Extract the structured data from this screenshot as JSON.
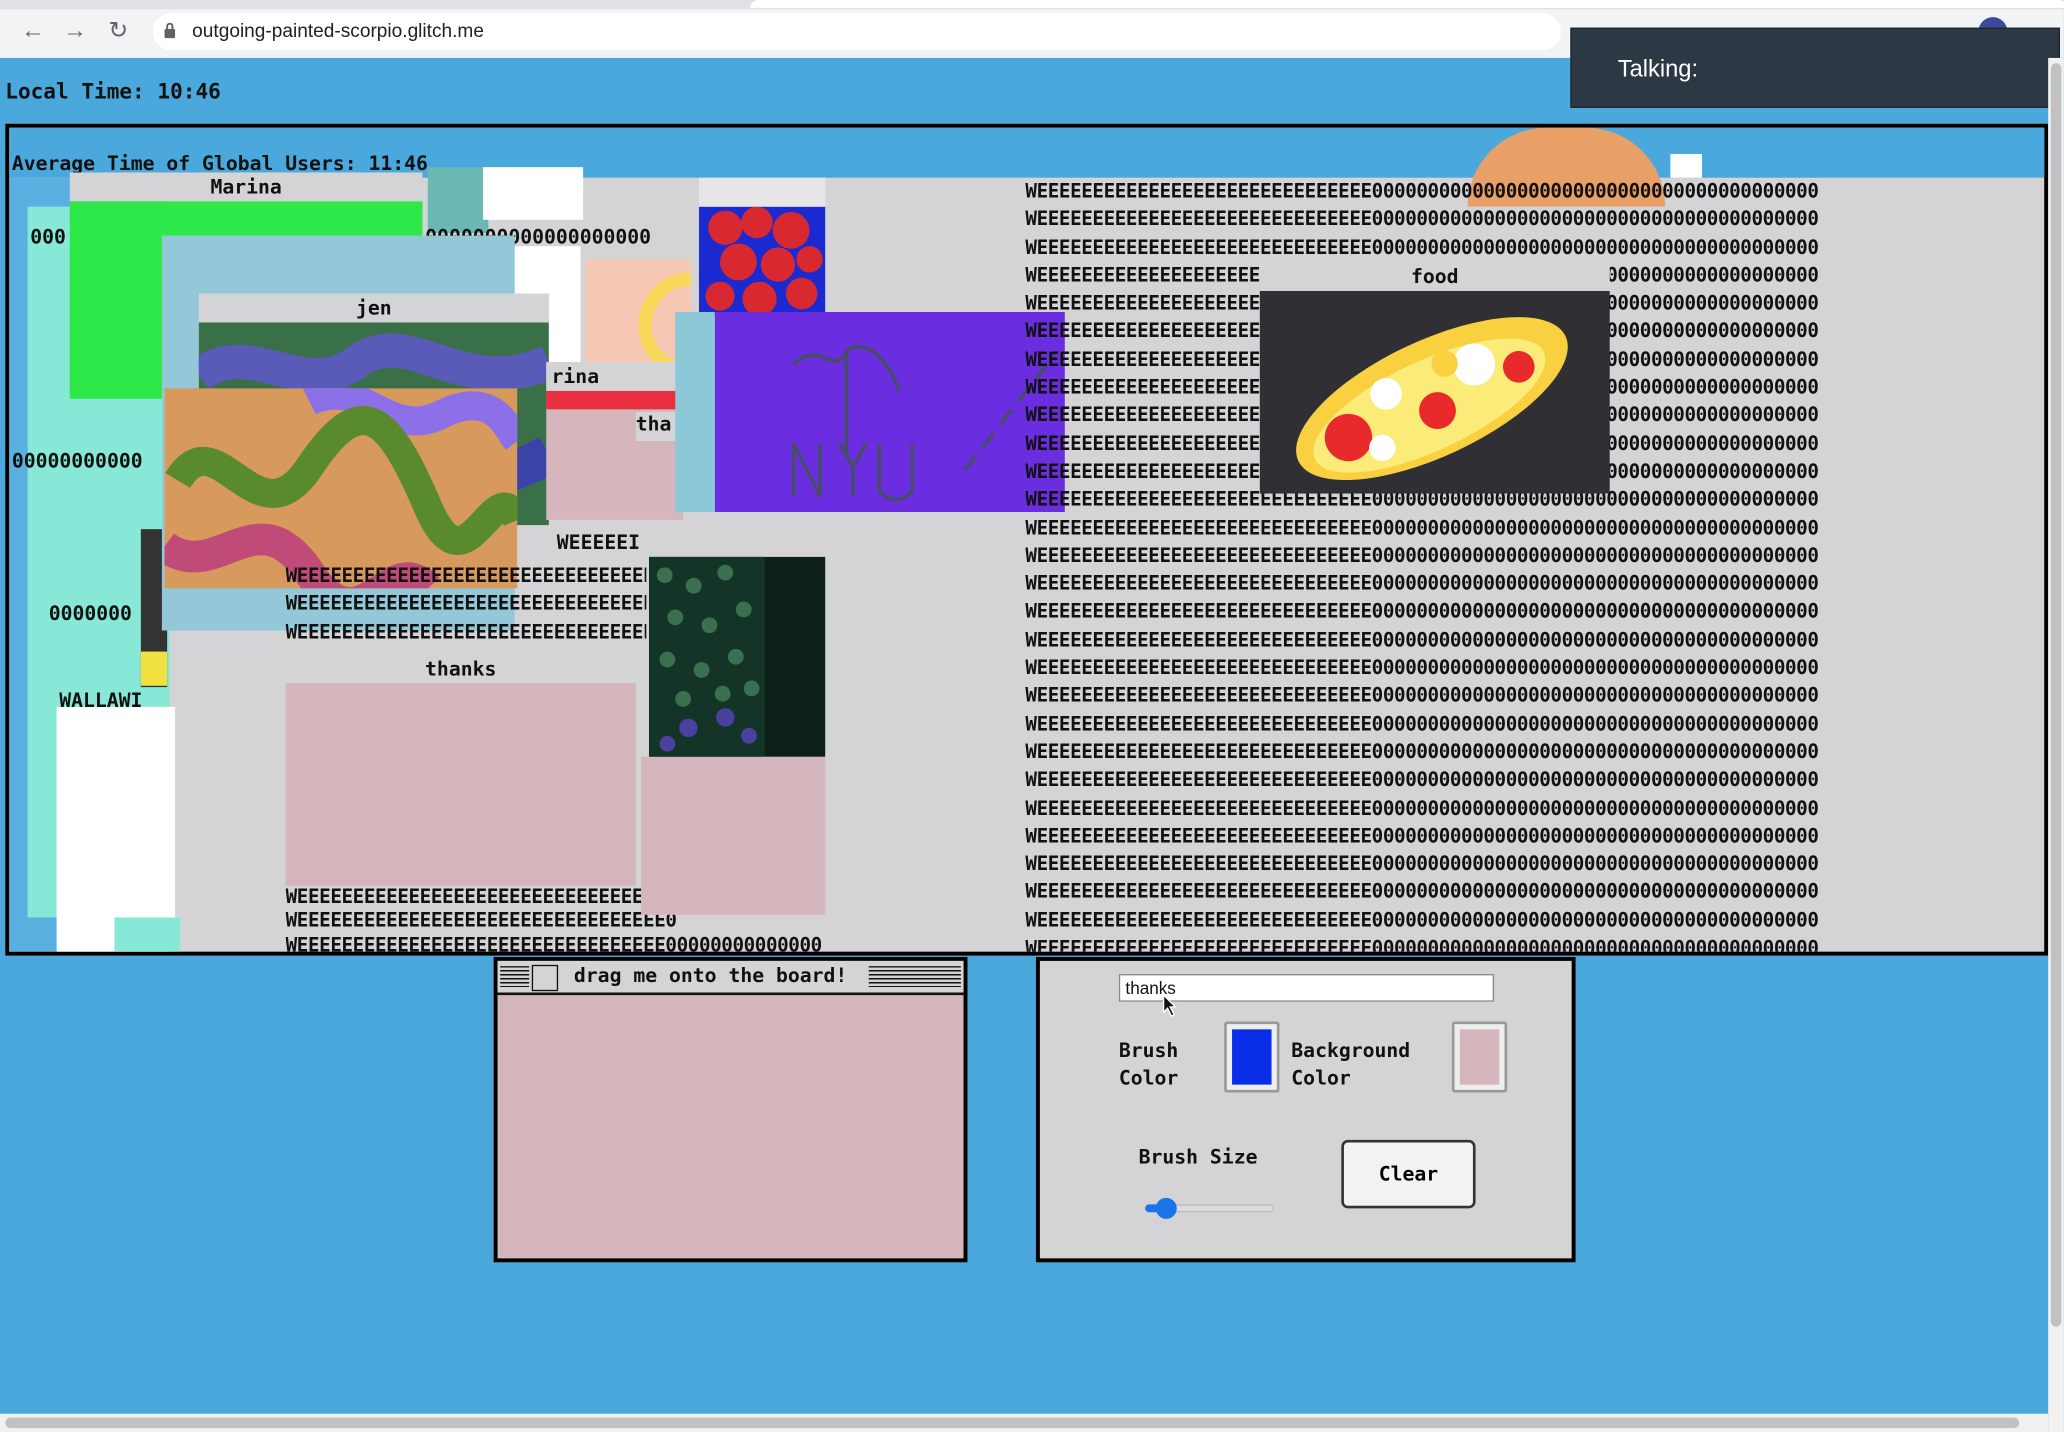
{
  "browser": {
    "url": "outgoing-painted-scorpio.glitch.me",
    "back_icon": "back-arrow-icon",
    "forward_icon": "forward-arrow-icon",
    "reload_icon": "reload-icon",
    "lock_icon": "lock-icon"
  },
  "talking_label": "Talking:",
  "local_time": "Local Time: 10:46",
  "average_time": "Average Time of Global Users: 11:46",
  "board": {
    "windows": {
      "marina": "Marina",
      "jen": "jen",
      "rina": "rina",
      "tha": "tha",
      "thanks": "thanks",
      "food": "food",
      "weeee_small": "WEEEEEI"
    },
    "fragments": {
      "zeros_a": "000",
      "zeros_b": "0000000000000000000",
      "zeros_c": "00000000000",
      "zeros_d": "0000000",
      "wallaw": "WALLAWI"
    },
    "wee_line": "WEEEEEEEEEEEEEEEEEEEEEEEEEEEEEE0000000000000000000000000000000000000000",
    "wee_left_line": "WEEEEEEEEEEEEEEEEEEEEEEEEEEEEEEEEE0",
    "wee_left_last": "WEEEEEEEEEEEEEEEEEEEEEEEEEEEEEEEEE00000000000000"
  },
  "drag_window": {
    "title": "drag me onto the board!"
  },
  "controls": {
    "title_input_value": "thanks",
    "brush_color_label_1": "Brush",
    "brush_color_label_2": "Color",
    "background_color_label_1": "Background",
    "background_color_label_2": "Color",
    "brush_color": "#0a2ee8",
    "background_color": "#d4b6bc",
    "brush_size_label": "Brush Size",
    "brush_size_value": 0.1,
    "clear_label": "Clear"
  }
}
